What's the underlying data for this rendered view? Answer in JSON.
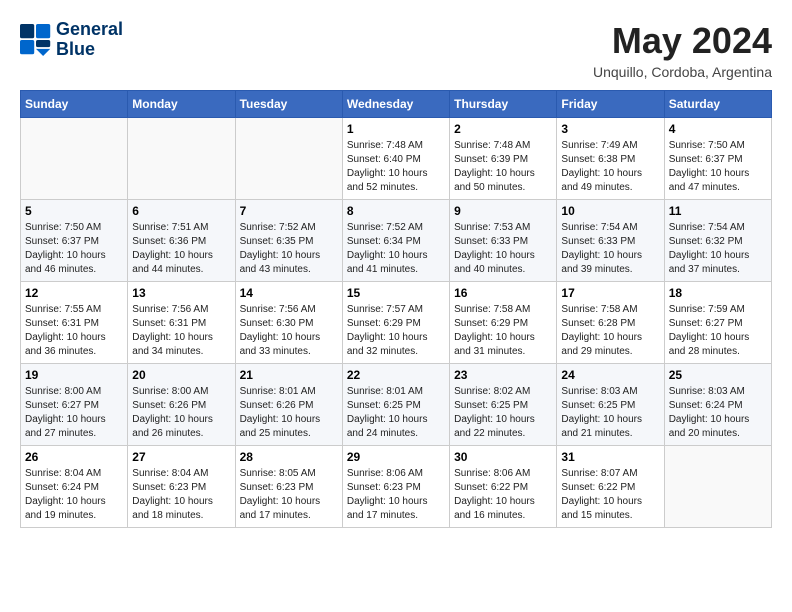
{
  "header": {
    "logo_line1": "General",
    "logo_line2": "Blue",
    "month": "May 2024",
    "location": "Unquillo, Cordoba, Argentina"
  },
  "weekdays": [
    "Sunday",
    "Monday",
    "Tuesday",
    "Wednesday",
    "Thursday",
    "Friday",
    "Saturday"
  ],
  "weeks": [
    [
      {
        "day": "",
        "info": ""
      },
      {
        "day": "",
        "info": ""
      },
      {
        "day": "",
        "info": ""
      },
      {
        "day": "1",
        "info": "Sunrise: 7:48 AM\nSunset: 6:40 PM\nDaylight: 10 hours\nand 52 minutes."
      },
      {
        "day": "2",
        "info": "Sunrise: 7:48 AM\nSunset: 6:39 PM\nDaylight: 10 hours\nand 50 minutes."
      },
      {
        "day": "3",
        "info": "Sunrise: 7:49 AM\nSunset: 6:38 PM\nDaylight: 10 hours\nand 49 minutes."
      },
      {
        "day": "4",
        "info": "Sunrise: 7:50 AM\nSunset: 6:37 PM\nDaylight: 10 hours\nand 47 minutes."
      }
    ],
    [
      {
        "day": "5",
        "info": "Sunrise: 7:50 AM\nSunset: 6:37 PM\nDaylight: 10 hours\nand 46 minutes."
      },
      {
        "day": "6",
        "info": "Sunrise: 7:51 AM\nSunset: 6:36 PM\nDaylight: 10 hours\nand 44 minutes."
      },
      {
        "day": "7",
        "info": "Sunrise: 7:52 AM\nSunset: 6:35 PM\nDaylight: 10 hours\nand 43 minutes."
      },
      {
        "day": "8",
        "info": "Sunrise: 7:52 AM\nSunset: 6:34 PM\nDaylight: 10 hours\nand 41 minutes."
      },
      {
        "day": "9",
        "info": "Sunrise: 7:53 AM\nSunset: 6:33 PM\nDaylight: 10 hours\nand 40 minutes."
      },
      {
        "day": "10",
        "info": "Sunrise: 7:54 AM\nSunset: 6:33 PM\nDaylight: 10 hours\nand 39 minutes."
      },
      {
        "day": "11",
        "info": "Sunrise: 7:54 AM\nSunset: 6:32 PM\nDaylight: 10 hours\nand 37 minutes."
      }
    ],
    [
      {
        "day": "12",
        "info": "Sunrise: 7:55 AM\nSunset: 6:31 PM\nDaylight: 10 hours\nand 36 minutes."
      },
      {
        "day": "13",
        "info": "Sunrise: 7:56 AM\nSunset: 6:31 PM\nDaylight: 10 hours\nand 34 minutes."
      },
      {
        "day": "14",
        "info": "Sunrise: 7:56 AM\nSunset: 6:30 PM\nDaylight: 10 hours\nand 33 minutes."
      },
      {
        "day": "15",
        "info": "Sunrise: 7:57 AM\nSunset: 6:29 PM\nDaylight: 10 hours\nand 32 minutes."
      },
      {
        "day": "16",
        "info": "Sunrise: 7:58 AM\nSunset: 6:29 PM\nDaylight: 10 hours\nand 31 minutes."
      },
      {
        "day": "17",
        "info": "Sunrise: 7:58 AM\nSunset: 6:28 PM\nDaylight: 10 hours\nand 29 minutes."
      },
      {
        "day": "18",
        "info": "Sunrise: 7:59 AM\nSunset: 6:27 PM\nDaylight: 10 hours\nand 28 minutes."
      }
    ],
    [
      {
        "day": "19",
        "info": "Sunrise: 8:00 AM\nSunset: 6:27 PM\nDaylight: 10 hours\nand 27 minutes."
      },
      {
        "day": "20",
        "info": "Sunrise: 8:00 AM\nSunset: 6:26 PM\nDaylight: 10 hours\nand 26 minutes."
      },
      {
        "day": "21",
        "info": "Sunrise: 8:01 AM\nSunset: 6:26 PM\nDaylight: 10 hours\nand 25 minutes."
      },
      {
        "day": "22",
        "info": "Sunrise: 8:01 AM\nSunset: 6:25 PM\nDaylight: 10 hours\nand 24 minutes."
      },
      {
        "day": "23",
        "info": "Sunrise: 8:02 AM\nSunset: 6:25 PM\nDaylight: 10 hours\nand 22 minutes."
      },
      {
        "day": "24",
        "info": "Sunrise: 8:03 AM\nSunset: 6:25 PM\nDaylight: 10 hours\nand 21 minutes."
      },
      {
        "day": "25",
        "info": "Sunrise: 8:03 AM\nSunset: 6:24 PM\nDaylight: 10 hours\nand 20 minutes."
      }
    ],
    [
      {
        "day": "26",
        "info": "Sunrise: 8:04 AM\nSunset: 6:24 PM\nDaylight: 10 hours\nand 19 minutes."
      },
      {
        "day": "27",
        "info": "Sunrise: 8:04 AM\nSunset: 6:23 PM\nDaylight: 10 hours\nand 18 minutes."
      },
      {
        "day": "28",
        "info": "Sunrise: 8:05 AM\nSunset: 6:23 PM\nDaylight: 10 hours\nand 17 minutes."
      },
      {
        "day": "29",
        "info": "Sunrise: 8:06 AM\nSunset: 6:23 PM\nDaylight: 10 hours\nand 17 minutes."
      },
      {
        "day": "30",
        "info": "Sunrise: 8:06 AM\nSunset: 6:22 PM\nDaylight: 10 hours\nand 16 minutes."
      },
      {
        "day": "31",
        "info": "Sunrise: 8:07 AM\nSunset: 6:22 PM\nDaylight: 10 hours\nand 15 minutes."
      },
      {
        "day": "",
        "info": ""
      }
    ]
  ]
}
